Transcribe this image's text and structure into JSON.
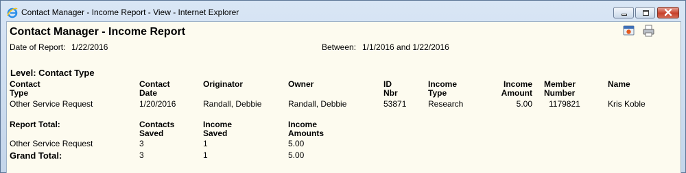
{
  "window": {
    "title": "Contact Manager - Income Report - View - Internet Explorer",
    "controls": {
      "minimize": "minimize",
      "maximize": "maximize",
      "close": "close"
    }
  },
  "report": {
    "title": "Contact Manager - Income Report",
    "date_label": "Date of Report:",
    "date_value": "1/22/2016",
    "between_label": "Between:",
    "between_value": "1/1/2016 and 1/22/2016",
    "level_label": "Level: Contact Type",
    "columns": [
      [
        "Contact",
        "Type"
      ],
      [
        "Contact",
        "Date"
      ],
      [
        "Originator"
      ],
      [
        "Owner"
      ],
      [
        "ID",
        "Nbr"
      ],
      [
        "Income",
        "Type"
      ],
      [
        "Income",
        "Amount"
      ],
      [
        "Member",
        "Number"
      ],
      [
        "Name"
      ]
    ],
    "row": [
      "Other Service Request",
      "1/20/2016",
      "Randall, Debbie",
      "Randall, Debbie",
      "53871",
      "Research",
      "5.00",
      "1179821",
      "Kris Koble"
    ],
    "totals": {
      "label": "Report Total:",
      "headers": [
        [
          "Contacts",
          "Saved"
        ],
        [
          "Income",
          "Saved"
        ],
        [
          "Income",
          "Amounts"
        ]
      ],
      "row": [
        "Other Service Request",
        "3",
        "1",
        "5.00"
      ],
      "grand_label": "Grand Total:",
      "grand_values": [
        "3",
        "1",
        "5.00"
      ]
    }
  },
  "toolbar": {
    "icons": [
      "ie-icon",
      "view-icon",
      "print-icon"
    ]
  }
}
